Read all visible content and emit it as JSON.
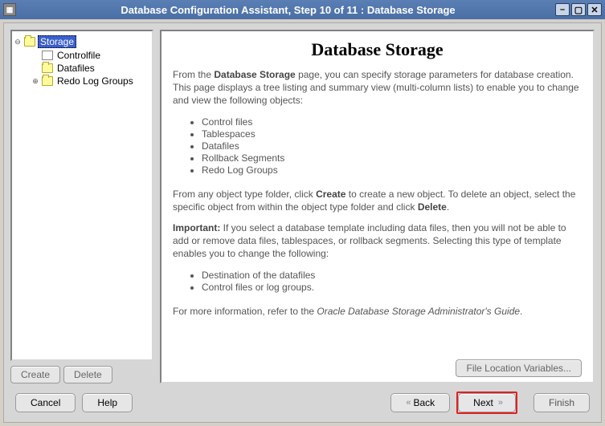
{
  "window": {
    "title": "Database Configuration Assistant, Step 10 of 11 : Database Storage"
  },
  "tree": {
    "root": "Storage",
    "items": [
      {
        "label": "Controlfile",
        "icon": "doc"
      },
      {
        "label": "Datafiles",
        "icon": "folder"
      },
      {
        "label": "Redo Log Groups",
        "icon": "folder",
        "expandable": true
      }
    ]
  },
  "tree_buttons": {
    "create": "Create",
    "delete": "Delete"
  },
  "content": {
    "heading": "Database Storage",
    "p1_a": "From the ",
    "p1_b": "Database Storage",
    "p1_c": " page, you can specify storage parameters for database creation. This page displays a tree listing and summary view (multi-column lists) to enable you to change and view the following objects:",
    "list1": [
      "Control files",
      "Tablespaces",
      "Datafiles",
      "Rollback Segments",
      "Redo Log Groups"
    ],
    "p2_a": "From any object type folder, click ",
    "p2_b": "Create",
    "p2_c": " to create a new object. To delete an object, select the specific object from within the object type folder and click ",
    "p2_d": "Delete",
    "p2_e": ".",
    "p3_a": "Important:",
    "p3_b": " If you select a database template including data files, then you will not be able to add or remove data files, tablespaces, or rollback segments. Selecting this type of template enables you to change the following:",
    "list2": [
      "Destination of the datafiles",
      "Control files or log groups."
    ],
    "p4_a": "For more information, refer to the ",
    "p4_b": "Oracle Database Storage Administrator's Guide",
    "p4_c": ".",
    "file_location": "File Location Variables..."
  },
  "nav": {
    "cancel": "Cancel",
    "help": "Help",
    "back": "Back",
    "next": "Next",
    "finish": "Finish"
  }
}
